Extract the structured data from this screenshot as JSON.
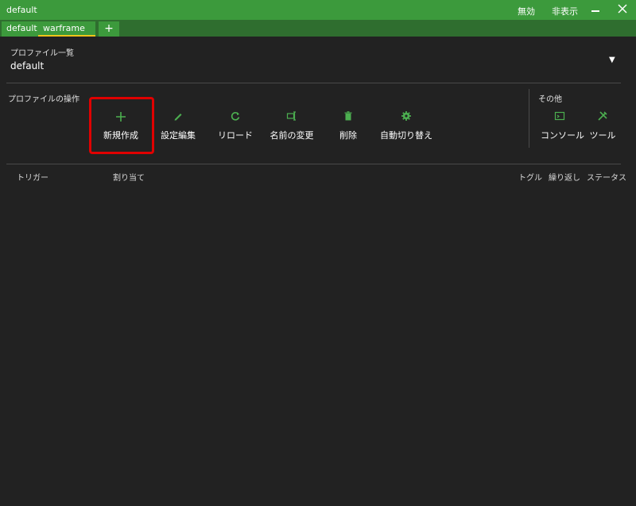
{
  "window": {
    "title": "default",
    "disable_label": "無効",
    "hide_label": "非表示",
    "minimize_icon": "minimize-icon",
    "close_icon": "close-icon"
  },
  "tabs": [
    {
      "label": "default"
    },
    {
      "label": "warframe"
    }
  ],
  "add_tab_icon": "plus-icon",
  "profile_list": {
    "label": "プロファイル一覧",
    "selected": "default"
  },
  "profile_ops": {
    "label": "プロファイルの操作",
    "actions": [
      {
        "label": "新規作成",
        "icon": "plus-icon"
      },
      {
        "label": "設定編集",
        "icon": "pencil-icon"
      },
      {
        "label": "リロード",
        "icon": "reload-icon"
      },
      {
        "label": "名前の変更",
        "icon": "rename-icon"
      },
      {
        "label": "削除",
        "icon": "trash-icon"
      },
      {
        "label": "自動切り替え",
        "icon": "gear-icon"
      }
    ]
  },
  "other": {
    "label": "その他",
    "actions": [
      {
        "label": "コンソール",
        "icon": "console-icon"
      },
      {
        "label": "ツール",
        "icon": "tools-icon"
      }
    ]
  },
  "table": {
    "headers": [
      "トリガー",
      "割り当て",
      "トグル",
      "繰り返し",
      "ステータス"
    ]
  },
  "colors": {
    "accent": "#3c9a3c",
    "tabbar": "#2f6e2f",
    "background": "#222222",
    "highlight": "#e00000",
    "active_tab_underline": "#f0c419"
  }
}
